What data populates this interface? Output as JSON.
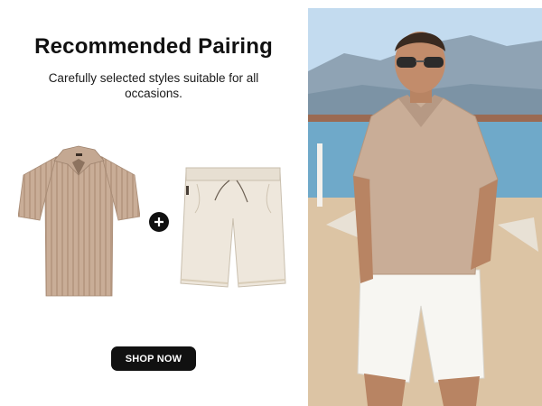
{
  "promo": {
    "title": "Recommended Pairing",
    "subtitle": "Carefully selected styles suitable for all occasions.",
    "cta_label": "SHOP NOW"
  },
  "products": [
    {
      "name": "polo-shirt",
      "color": "#c9ad97"
    },
    {
      "name": "shorts",
      "color": "#eee7dc"
    }
  ],
  "icons": {
    "plus": "plus-icon"
  },
  "colors": {
    "button_bg": "#111111",
    "button_text": "#ffffff",
    "sky": "#c3dbef",
    "sea": "#6fa9c9",
    "sand": "#dcc4a4"
  }
}
